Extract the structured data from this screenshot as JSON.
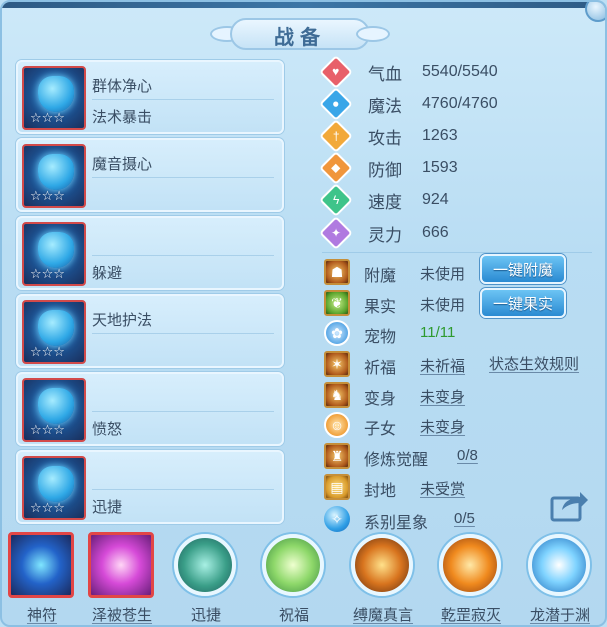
{
  "title": "战备",
  "equipment": [
    {
      "name1": "群体净心",
      "name2": "法术暴击",
      "stars": "☆☆☆"
    },
    {
      "name1": "魔音摄心",
      "name2": "",
      "stars": "☆☆☆"
    },
    {
      "name1": "",
      "name2": "躲避",
      "stars": "☆☆☆"
    },
    {
      "name1": "天地护法",
      "name2": "",
      "stars": "☆☆☆"
    },
    {
      "name1": "",
      "name2": "愤怒",
      "stars": "☆☆☆"
    },
    {
      "name1": "",
      "name2": "迅捷",
      "stars": "☆☆☆"
    }
  ],
  "stats": [
    {
      "label": "气血",
      "value": "5540/5540",
      "icon": "heart-icon",
      "color": "#e8606a"
    },
    {
      "label": "魔法",
      "value": "4760/4760",
      "icon": "magic-icon",
      "color": "#3aa6e8"
    },
    {
      "label": "攻击",
      "value": "1263",
      "icon": "sword-icon",
      "color": "#f2a93a"
    },
    {
      "label": "防御",
      "value": "1593",
      "icon": "shield-icon",
      "color": "#f0963c"
    },
    {
      "label": "速度",
      "value": "924",
      "icon": "lightning-icon",
      "color": "#3ec48a"
    },
    {
      "label": "灵力",
      "value": "666",
      "icon": "spirit-icon",
      "color": "#b07ae0"
    }
  ],
  "features": {
    "enchant": {
      "label": "附魔",
      "value": "未使用",
      "button": "一键附魔"
    },
    "fruit": {
      "label": "果实",
      "value": "未使用",
      "button": "一键果实"
    },
    "pet": {
      "label": "宠物",
      "value": "11/11"
    },
    "blessing": {
      "label": "祈福",
      "value": "未祈福",
      "rule_link": "状态生效规则"
    },
    "transform": {
      "label": "变身",
      "value": "未变身"
    },
    "children": {
      "label": "子女",
      "value": "未变身"
    },
    "cultivation": {
      "label": "修炼觉醒",
      "value": "0/8"
    },
    "fief": {
      "label": "封地",
      "value": "未受赏"
    },
    "star_system": {
      "label": "系别星象",
      "value": "0/5"
    }
  },
  "skills": [
    {
      "label": "神符"
    },
    {
      "label": "泽被苍生"
    },
    {
      "label": "迅捷"
    },
    {
      "label": "祝福"
    },
    {
      "label": "缚魔真言"
    },
    {
      "label": "乾罡寂灭"
    },
    {
      "label": "龙潜于渊"
    }
  ]
}
